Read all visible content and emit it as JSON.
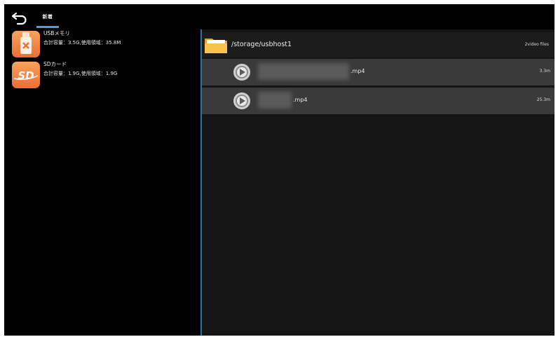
{
  "header": {
    "back_icon": "back-arrow-icon",
    "tab_label": "新着"
  },
  "storages": [
    {
      "name": "USBメモリ",
      "detail": "合計容量：3.5G,使用領域：35.8M",
      "icon": "usb-drive-icon"
    },
    {
      "name": "SDカード",
      "detail": "合計容量：1.9G,使用領域：1.9G",
      "icon": "sd-card-icon",
      "icon_text": "SD"
    }
  ],
  "browser": {
    "path": "/storage/usbhost1",
    "file_count": "2video files",
    "folder_icon": "folder-icon"
  },
  "files": [
    {
      "name": ".mp4",
      "size": "3.3m",
      "icon": "video-file-icon"
    },
    {
      "name": ".mp4",
      "size": "25.3m",
      "icon": "video-file-icon"
    }
  ],
  "colors": {
    "accent": "#3fa2ea",
    "icon_orange": "#ee6d33",
    "row_bg": "#3a3a3a",
    "panel_bg": "#151515"
  }
}
